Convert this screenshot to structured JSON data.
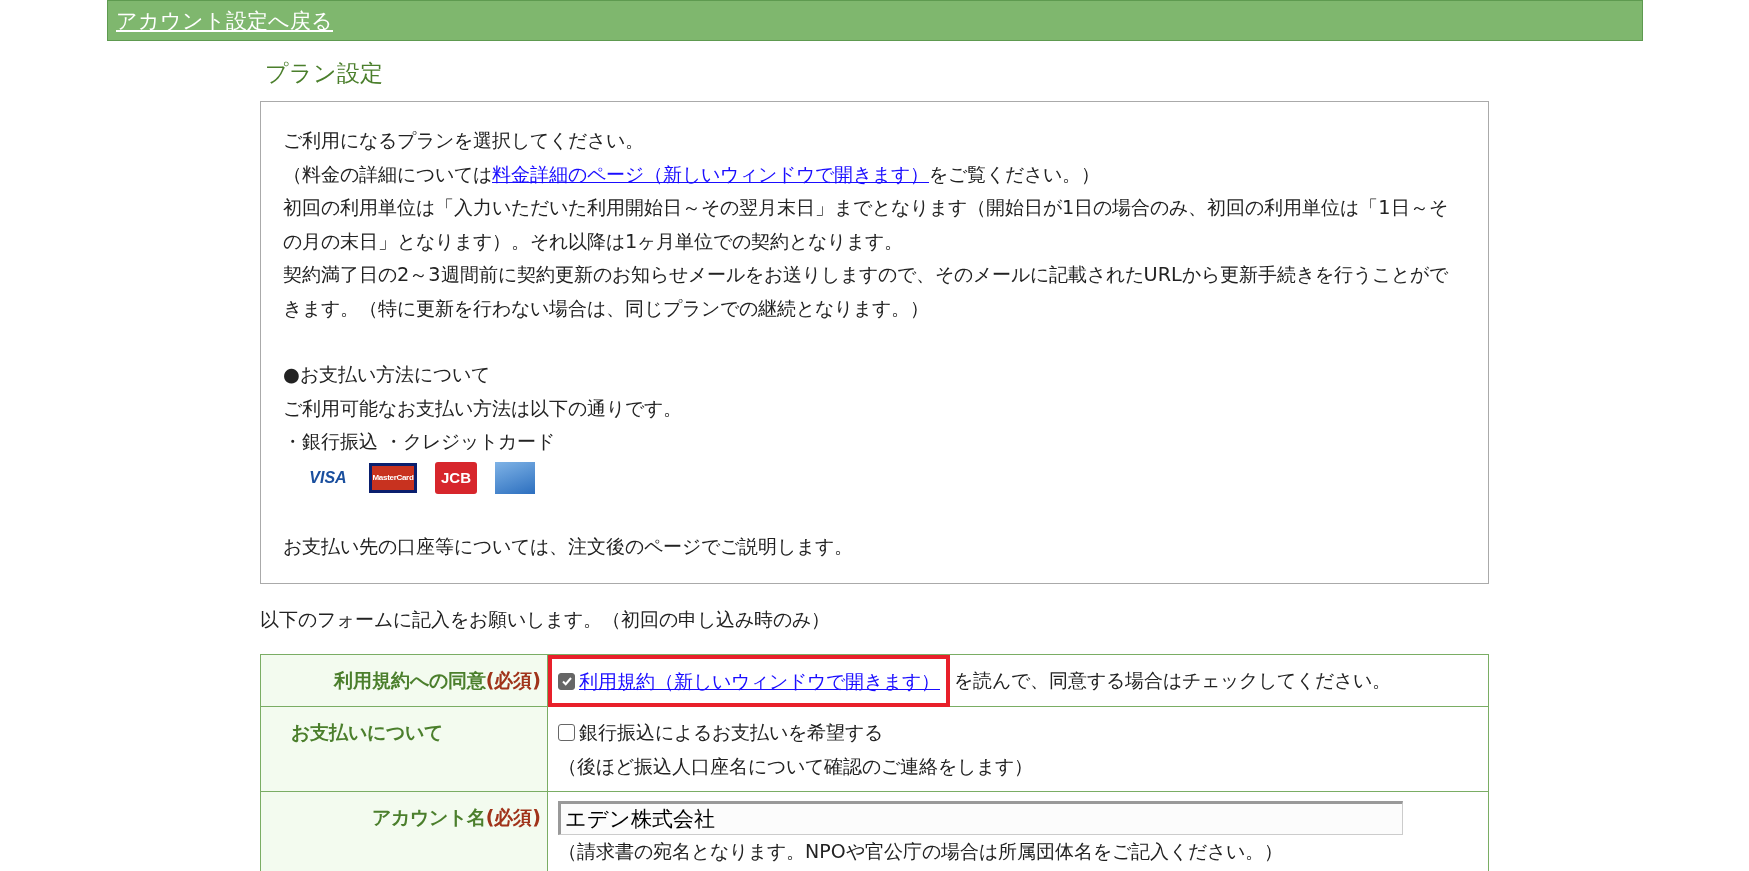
{
  "header": {
    "back_link": "アカウント設定へ戻る"
  },
  "heading": "プラン設定",
  "info": {
    "intro": "ご利用になるプランを選択してください。",
    "fee_prefix": "（料金の詳細については",
    "fee_link": "料金詳細のページ（新しいウィンドウで開きます）",
    "fee_suffix": "をご覧ください。）",
    "paragraphs": [
      "初回の利用単位は「入力いただいた利用開始日～その翌月末日」までとなります（開始日が1日の場合のみ、初回の利用単位は「1日～その月の末日」となります）。それ以降は1ヶ月単位での契約となります。",
      "契約満了日の2～3週間前に契約更新のお知らせメールをお送りしますので、そのメールに記載されたURLから更新手続きを行うことができます。（特に更新を行わない場合は、同じプランでの継続となります。）"
    ],
    "payment_heading": "●お支払い方法について",
    "payment_text": "ご利用可能なお支払い方法は以下の通りです。",
    "payment_methods": "・銀行振込 ・クレジットカード",
    "cards": [
      {
        "kind": "visa",
        "label": "VISA"
      },
      {
        "kind": "mastercard",
        "label": "MasterCard"
      },
      {
        "kind": "jcb",
        "label": "JCB"
      },
      {
        "kind": "amex"
      }
    ],
    "footer": "お支払い先の口座等については、注文後のページでご説明します。"
  },
  "form_intro": "以下のフォームに記入をお願いします。（初回の申し込み時のみ）",
  "form_rows": [
    {
      "kind": "agreement",
      "label": "利用規約への同意",
      "required": "(必須)",
      "checked": true,
      "highlighted": true,
      "link": "利用規約（新しいウィンドウで開きます）",
      "text": "を読んで、同意する場合はチェックしてください。"
    },
    {
      "kind": "checkbox",
      "label": "お支払いについて",
      "checked": false,
      "text": "銀行振込によるお支払いを希望する",
      "note": "（後ほど振込人口座名について確認のご連絡をします）"
    },
    {
      "kind": "input",
      "label": "アカウント名",
      "required": "(必須)",
      "value": "エデン株式会社",
      "note": "（請求書の宛名となります。NPOや官公庁の場合は所属団体名をご記入ください。）"
    }
  ]
}
